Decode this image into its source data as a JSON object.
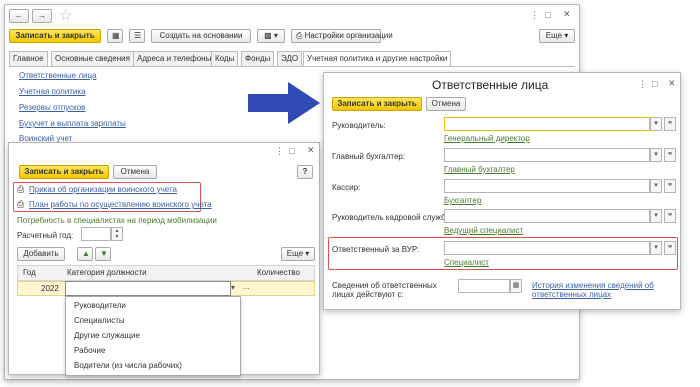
{
  "org_window": {
    "toolbar": {
      "save_close": "Записать и закрыть",
      "create_based": "Создать на основании",
      "org_settings": "Настройки организации",
      "more": "Еще"
    },
    "tabs": [
      "Главное",
      "Основные сведения",
      "Адреса и телефоны",
      "Коды",
      "Фонды",
      "ЭДО",
      "Учетная политика и другие настройки"
    ],
    "links": [
      "Ответственные лица",
      "Учетная политика",
      "Резервы отпусков",
      "Бухучет и выплата зарплаты",
      "Воинский учет"
    ]
  },
  "military_window": {
    "save_close": "Записать и закрыть",
    "cancel": "Отмена",
    "help": "?",
    "order_link": "Приказ об организации воинского учета",
    "plan_link": "План работы по осуществлению воинского учета",
    "need_title": "Потребность в специалистах на период мобилизации",
    "year_label": "Расчетный год:",
    "add": "Добавить",
    "more": "Еще",
    "table_headers": [
      "Год",
      "Категория должности",
      "Количество"
    ],
    "row_year": "2022",
    "dropdown": [
      "Руководители",
      "Специалисты",
      "Другие служащие",
      "Рабочие",
      "Водители (из числа рабочих)"
    ]
  },
  "resp_window": {
    "title": "Ответственные лица",
    "save_close": "Записать и закрыть",
    "cancel": "Отмена",
    "fields": [
      {
        "label": "Руководитель:",
        "hint": "Генеральный директор"
      },
      {
        "label": "Главный бухгалтер:",
        "hint": "Главный бухгалтер"
      },
      {
        "label": "Кассир:",
        "hint": "Бухгалтер"
      },
      {
        "label": "Руководитель кадровой службы:",
        "hint": "Ведущий специалист"
      },
      {
        "label": "Ответственный за ВУР:",
        "hint": "Специалист"
      }
    ],
    "info_label": "Сведения об ответственных лицах действуют с:",
    "history_link": "История изменения сведений об ответственных лицах"
  },
  "colors": {
    "accent_yellow": "#f2c800",
    "arrow_blue": "#2f49b5",
    "highlight_red": "#d9534f",
    "link_blue": "#3a5fa8"
  }
}
